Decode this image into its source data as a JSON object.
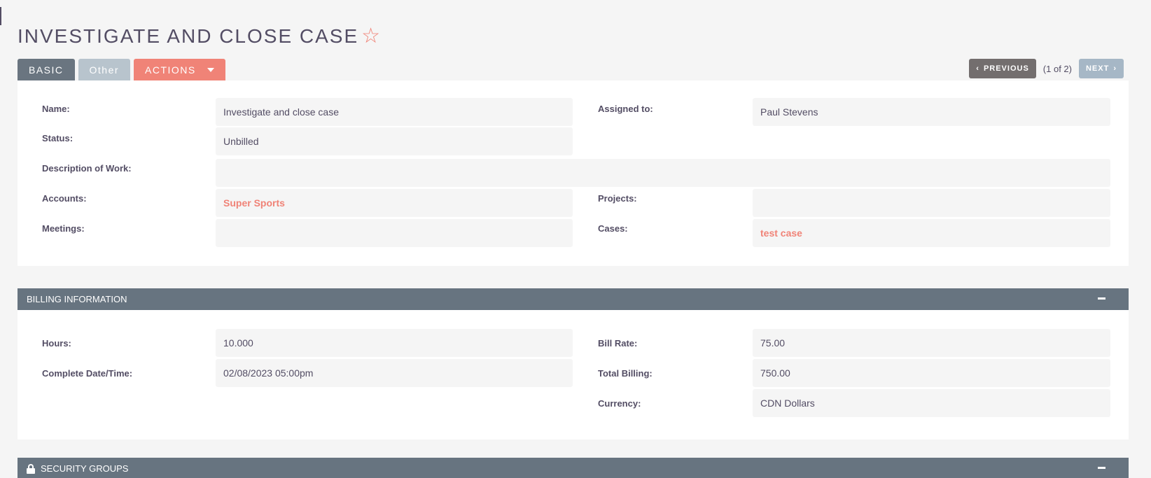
{
  "title": "INVESTIGATE AND CLOSE CASE",
  "tabs": {
    "basic": "BASIC",
    "other": "Other",
    "actions": "ACTIONS"
  },
  "pager": {
    "previous": "PREVIOUS",
    "count": "(1 of 2)",
    "next": "NEXT"
  },
  "basic": {
    "name_label": "Name:",
    "name_value": "Investigate and close case",
    "assigned_label": "Assigned to:",
    "assigned_value": "Paul Stevens",
    "status_label": "Status:",
    "status_value": "Unbilled",
    "description_label": "Description of Work:",
    "description_value": "",
    "accounts_label": "Accounts:",
    "accounts_value": "Super Sports",
    "projects_label": "Projects:",
    "projects_value": "",
    "meetings_label": "Meetings:",
    "meetings_value": "",
    "cases_label": "Cases:",
    "cases_value": "test case"
  },
  "billing": {
    "header": "BILLING INFORMATION",
    "hours_label": "Hours:",
    "hours_value": "10.000",
    "bill_rate_label": "Bill Rate:",
    "bill_rate_value": "75.00",
    "complete_label": "Complete Date/Time:",
    "complete_value": "02/08/2023 05:00pm",
    "total_label": "Total Billing:",
    "total_value": "750.00",
    "currency_label": "Currency:",
    "currency_value": "CDN Dollars"
  },
  "security": {
    "header": "SECURITY GROUPS"
  },
  "colors": {
    "accent": "#f08377",
    "header_bg": "#677480",
    "tab_active": "#6a7580",
    "tab_inactive": "#b8c4cd"
  }
}
